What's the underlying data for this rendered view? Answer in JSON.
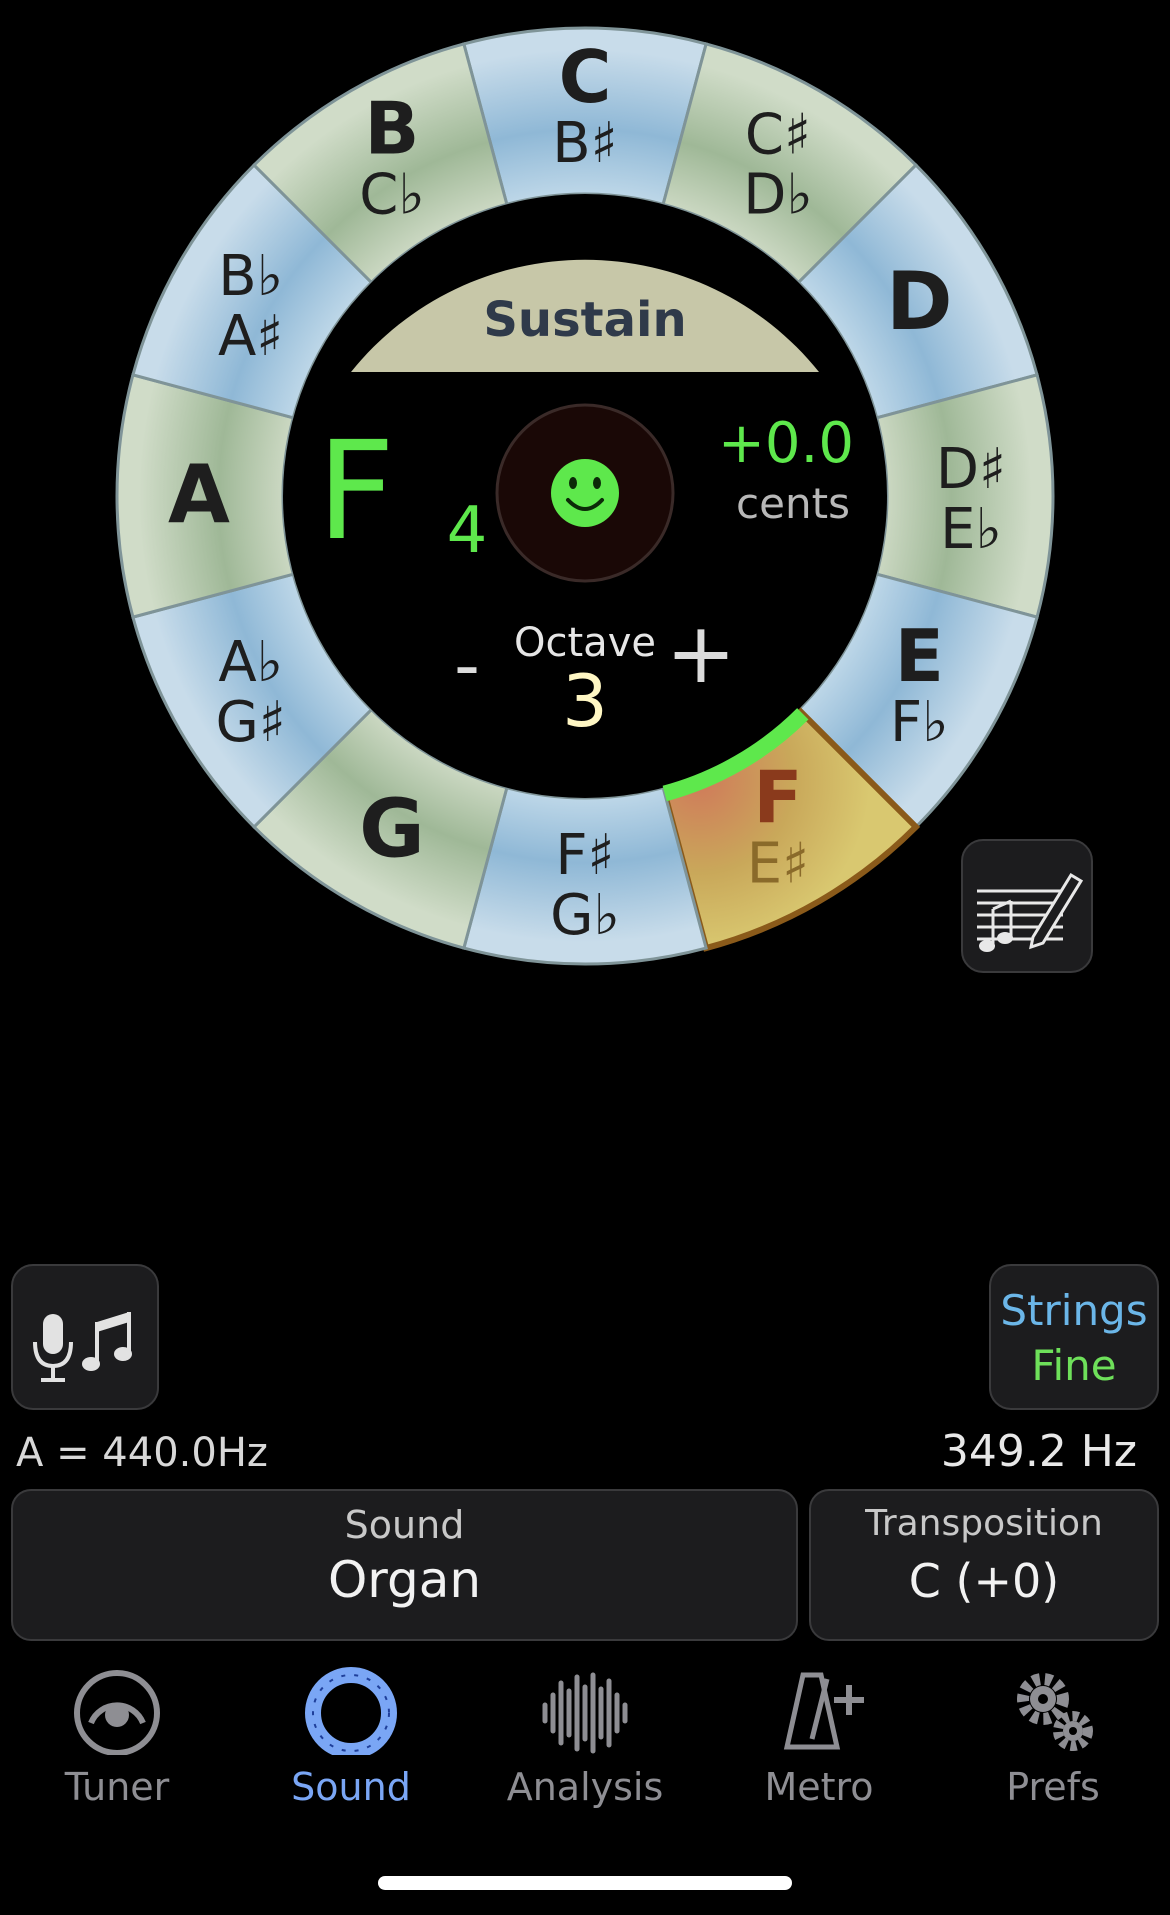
{
  "wheel": {
    "notes": [
      {
        "main": "C",
        "alt": "B♯"
      },
      {
        "main": "C♯",
        "alt": "D♭"
      },
      {
        "main": "D",
        "alt": ""
      },
      {
        "main": "D♯",
        "alt": "E♭"
      },
      {
        "main": "E",
        "alt": "F♭"
      },
      {
        "main": "F",
        "alt": "E♯"
      },
      {
        "main": "F♯",
        "alt": "G♭"
      },
      {
        "main": "G",
        "alt": ""
      },
      {
        "main": "A♭",
        "alt": "G♯"
      },
      {
        "main": "A",
        "alt": ""
      },
      {
        "main": "B♭",
        "alt": "A♯"
      },
      {
        "main": "B",
        "alt": "C♭"
      }
    ],
    "selected_note": "F",
    "sustain_label": "Sustain",
    "current_note": "F",
    "current_octave": "4",
    "cents_value": "+0.0",
    "cents_label": "cents",
    "octave_label": "Octave",
    "octave_value": "3",
    "octave_minus": "-",
    "octave_plus": "+"
  },
  "controls": {
    "strings_label": "Strings",
    "fine_label": "Fine"
  },
  "info": {
    "reference": "A = 440.0Hz",
    "frequency": "349.2 Hz"
  },
  "sound": {
    "caption": "Sound",
    "value": "Organ"
  },
  "transposition": {
    "caption": "Transposition",
    "value": "C (+0)"
  },
  "tabs": [
    {
      "label": "Tuner",
      "icon": "tuner-icon"
    },
    {
      "label": "Sound",
      "icon": "note-wheel-icon"
    },
    {
      "label": "Analysis",
      "icon": "waveform-icon"
    },
    {
      "label": "Metro",
      "icon": "metronome-icon"
    },
    {
      "label": "Prefs",
      "icon": "gears-icon"
    }
  ],
  "active_tab": "Sound",
  "colors": {
    "accent_green": "#5ee84c",
    "tab_active": "#7aa6f5",
    "segment_blue": "#a9c9de",
    "segment_green": "#b7cbb0",
    "sustain_fill": "#c7c7a8"
  }
}
